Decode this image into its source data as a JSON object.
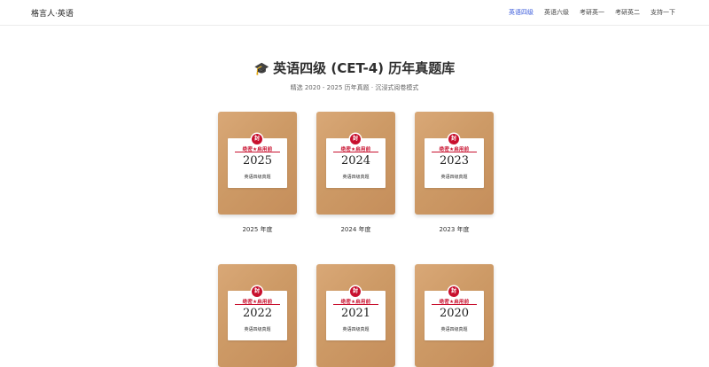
{
  "header": {
    "brand": "格言人·英语",
    "nav": [
      {
        "label": "英语四级",
        "active": true
      },
      {
        "label": "英语六级",
        "active": false
      },
      {
        "label": "考研英一",
        "active": false
      },
      {
        "label": "考研英二",
        "active": false
      },
      {
        "label": "支持一下",
        "active": false
      }
    ]
  },
  "hero": {
    "icon": "graduation-cap-icon",
    "title": "英语四级 (CET-4) 历年真题库",
    "subtitle": "精选 2020 - 2025 历年真题 · 沉浸式阅卷模式"
  },
  "cards": [
    {
      "seal": "封",
      "secret": "绝密★启用前",
      "year": "2025",
      "paper_label": "英语四级真题",
      "caption": "2025 年度"
    },
    {
      "seal": "封",
      "secret": "绝密★启用前",
      "year": "2024",
      "paper_label": "英语四级真题",
      "caption": "2024 年度"
    },
    {
      "seal": "封",
      "secret": "绝密★启用前",
      "year": "2023",
      "paper_label": "英语四级真题",
      "caption": "2023 年度"
    },
    {
      "seal": "封",
      "secret": "绝密★启用前",
      "year": "2022",
      "paper_label": "英语四级真题",
      "caption": ""
    },
    {
      "seal": "封",
      "secret": "绝密★启用前",
      "year": "2021",
      "paper_label": "英语四级真题",
      "caption": ""
    },
    {
      "seal": "封",
      "secret": "绝密★启用前",
      "year": "2020",
      "paper_label": "英语四级真题",
      "caption": ""
    }
  ],
  "colors": {
    "accent": "#3b5bdb",
    "folder": "#cd9a66",
    "seal": "#c8102e"
  }
}
